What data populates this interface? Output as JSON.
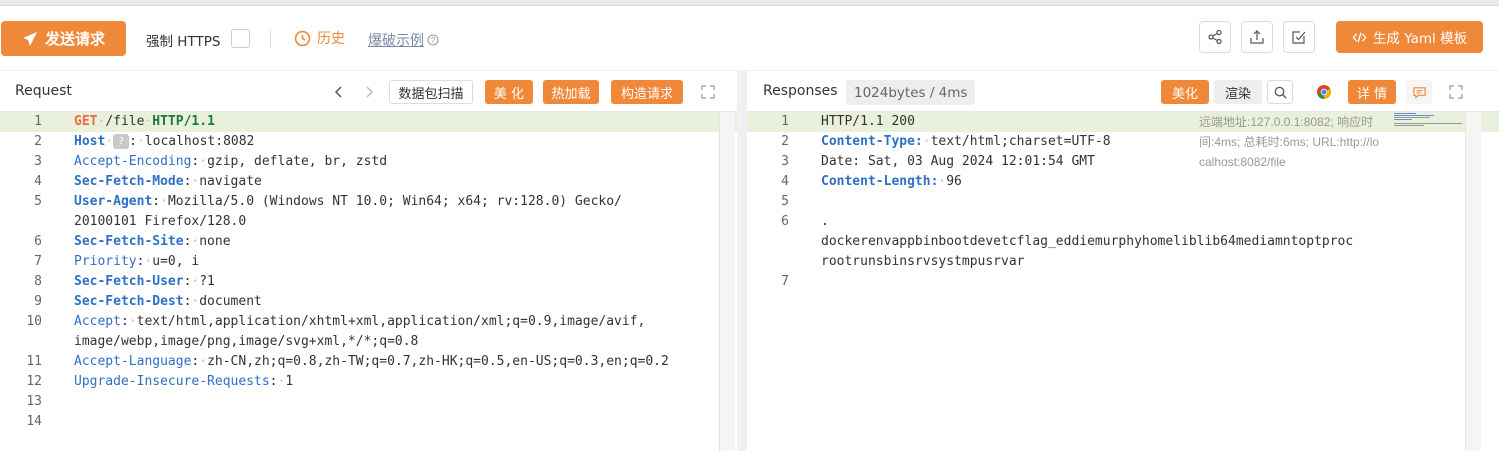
{
  "toolbar": {
    "send_label": "发送请求",
    "https_label": "强制 HTTPS",
    "history_label": "历史",
    "example_label": "爆破示例",
    "yaml_label": "生成 Yaml 模板"
  },
  "request": {
    "title": "Request",
    "buttons": {
      "scan": "数据包扫描",
      "beautify": "美 化",
      "hot_load": "热加载",
      "build": "构造请求"
    },
    "lines": [
      {
        "num": "1"
      },
      {
        "num": "2"
      },
      {
        "num": "3"
      },
      {
        "num": "4"
      },
      {
        "num": "5"
      },
      {
        "num": "6"
      },
      {
        "num": "7"
      },
      {
        "num": "8"
      },
      {
        "num": "9"
      },
      {
        "num": "10"
      },
      {
        "num": "11"
      },
      {
        "num": "12"
      },
      {
        "num": "13"
      },
      {
        "num": "14"
      }
    ],
    "content": {
      "method": "GET",
      "path": "/file",
      "version": "HTTP/1.1",
      "host_key": "Host",
      "host_hint": "?",
      "host_val": "localhost:8082",
      "ae_key": "Accept-Encoding",
      "ae_val": "gzip, deflate, br, zstd",
      "sfm_key": "Sec-Fetch-Mode",
      "sfm_val": "navigate",
      "ua_key": "User-Agent",
      "ua_val_1": "Mozilla/5.0 (Windows NT 10.0; Win64; x64; rv:128.0) Gecko/",
      "ua_val_2": "20100101 Firefox/128.0",
      "sfs_key": "Sec-Fetch-Site",
      "sfs_val": "none",
      "pri_key": "Priority",
      "pri_val": "u=0, i",
      "sfu_key": "Sec-Fetch-User",
      "sfu_val": "?1",
      "sfd_key": "Sec-Fetch-Dest",
      "sfd_val": "document",
      "acc_key": "Accept",
      "acc_val_1": "text/html,application/xhtml+xml,application/xml;q=0.9,image/avif,",
      "acc_val_2": "image/webp,image/png,image/svg+xml,*/*;q=0.8",
      "al_key": "Accept-Language",
      "al_val": "zh-CN,zh;q=0.8,zh-TW;q=0.7,zh-HK;q=0.5,en-US;q=0.3,en;q=0.2",
      "uir_key": "Upgrade-Insecure-Requests",
      "uir_val": "1"
    }
  },
  "response": {
    "title": "Responses",
    "size_badge": "1024bytes / 4ms",
    "buttons": {
      "beautify": "美化",
      "render": "渲染",
      "detail": "详 情"
    },
    "meta_1": "远端地址:127.0.0.1:8082; 响应时",
    "meta_2": "间:4ms; 总耗时:6ms; URL:http://lo",
    "meta_3": "calhost:8082/file",
    "lines": [
      {
        "num": "1"
      },
      {
        "num": "2"
      },
      {
        "num": "3"
      },
      {
        "num": "4"
      },
      {
        "num": "5"
      },
      {
        "num": "6"
      },
      {
        "num": "7"
      }
    ],
    "content": {
      "status": "HTTP/1.1 200",
      "ct_key": "Content-Type:",
      "ct_val": "text/html;charset=UTF-8",
      "date_line": "Date: Sat, 03 Aug 2024 12:01:54 GMT",
      "cl_key": "Content-Length:",
      "cl_val": "96",
      "body_1": ".",
      "body_2": "dockerenvappbinbootdevetcflag_eddiemurphyhomeliblib64mediamntoptproc",
      "body_3": "rootrunsbinsrvsystmpusrvar"
    }
  },
  "colors": {
    "accent": "#f0883a",
    "keyword": "#2f6fc6",
    "method": "#f06a3a",
    "version": "#1a7a3a",
    "active_line": "#e9f0db"
  },
  "icons": [
    "send-icon",
    "clock-icon",
    "question-icon",
    "share-icon",
    "upload-icon",
    "checkbox-icon",
    "code-icon",
    "chevron-left-icon",
    "chevron-right-icon",
    "expand-icon",
    "search-icon",
    "chrome-icon",
    "comment-icon"
  ]
}
